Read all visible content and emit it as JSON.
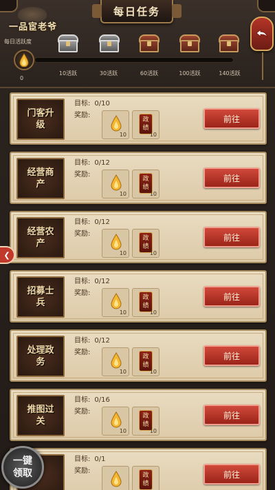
{
  "header": {
    "title": "每日任务",
    "logo_text": "一品宦老爷",
    "activity_label": "每日活跃度",
    "activity_value": "0",
    "activity_progress": 0,
    "tiers": [
      {
        "label": "10活跃",
        "icon": "silver-chest-icon"
      },
      {
        "label": "30活跃",
        "icon": "silver-chest-icon"
      },
      {
        "label": "60活跃",
        "icon": "treasure-chest-icon"
      },
      {
        "label": "100活跃",
        "icon": "treasure-chest-icon"
      },
      {
        "label": "140活跃",
        "icon": "treasure-chest-icon"
      }
    ],
    "back_icon": "back-arrow-icon"
  },
  "task_labels": {
    "goal": "目标:",
    "reward": "奖励:",
    "go": "前往",
    "merit": "政绩"
  },
  "tasks": [
    {
      "name": "门客升级",
      "goal": "0/10",
      "reward_drop": "10",
      "reward_merit": "10"
    },
    {
      "name": "经营商产",
      "goal": "0/12",
      "reward_drop": "10",
      "reward_merit": "10"
    },
    {
      "name": "经营农产",
      "goal": "0/12",
      "reward_drop": "10",
      "reward_merit": "10"
    },
    {
      "name": "招募士兵",
      "goal": "0/12",
      "reward_drop": "10",
      "reward_merit": "10"
    },
    {
      "name": "处理政务",
      "goal": "0/12",
      "reward_drop": "10",
      "reward_merit": "10"
    },
    {
      "name": "推图过关",
      "goal": "0/16",
      "reward_drop": "10",
      "reward_merit": "10"
    },
    {
      "name": "",
      "goal": "0/1",
      "reward_drop": "",
      "reward_merit": ""
    }
  ],
  "claim_all": "一键领取",
  "colors": {
    "accent_red": "#c0392b",
    "gold": "#e3a42e",
    "parchment": "#e9dcc1"
  }
}
